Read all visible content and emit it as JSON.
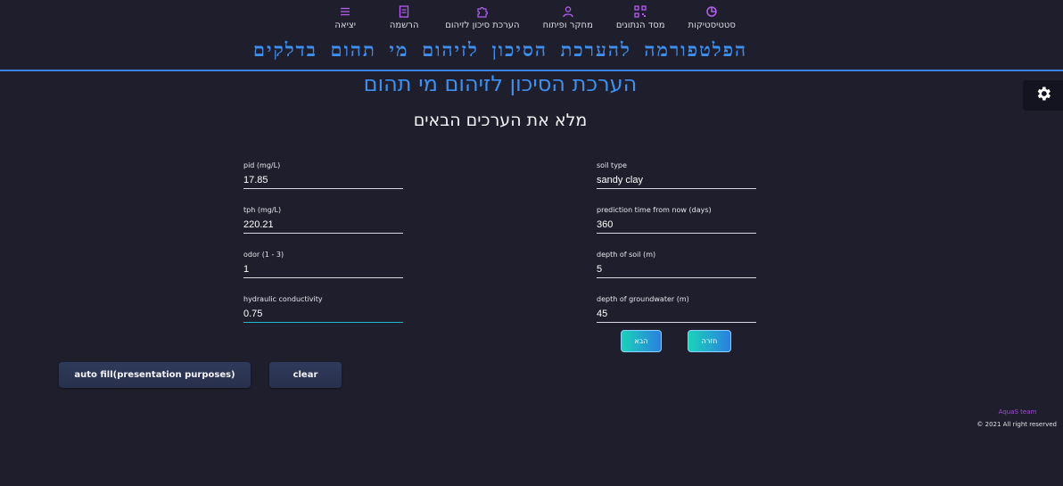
{
  "nav": {
    "items": [
      {
        "label": "סטטיסטיקות",
        "icon": "pie-chart-icon"
      },
      {
        "label": "מסד הנתונים",
        "icon": "qr-code-icon"
      },
      {
        "label": "מחקר ופיתוח",
        "icon": "user-icon"
      },
      {
        "label": "הערכת סיכון לזיהום",
        "icon": "puzzle-icon"
      },
      {
        "label": "הרשמה",
        "icon": "document-icon"
      },
      {
        "label": "יציאה",
        "icon": "menu-lines-icon"
      }
    ],
    "icon_color": "#b45ef0"
  },
  "site_title": "הפלטפורמה להערכת הסיכון לזיהום מי תהום בדלקים",
  "page_title": "הערכת הסיכון לזיהום מי תהום",
  "page_subtitle": "מלא את הערכים הבאים",
  "settings_icon": "gear-icon",
  "form": {
    "left": [
      {
        "label": "pid (mg/L)",
        "value": "17.85"
      },
      {
        "label": "tph (mg/L)",
        "value": "220.21"
      },
      {
        "label": "odor (1 - 3)",
        "value": "1"
      },
      {
        "label": "hydraulic conductivity",
        "value": "0.75"
      }
    ],
    "right": [
      {
        "label": "soil type",
        "value": "sandy clay"
      },
      {
        "label": "prediction time from now (days)",
        "value": "360"
      },
      {
        "label": "depth of soil (m)",
        "value": "5"
      },
      {
        "label": "depth of groundwater (m)",
        "value": "45"
      }
    ]
  },
  "buttons": {
    "next": "הבא",
    "back": "חזרה",
    "autofill": "auto fill(presentation purposes)",
    "clear": "clear"
  },
  "footer": {
    "team": "AquaS team",
    "copyright": "© 2021 All right reserved"
  },
  "colors": {
    "background": "#1f1e2c",
    "accent_blue": "#3d8ff0",
    "nav_icon": "#b45ef0",
    "button_gradient_start": "#1ad3b9",
    "button_gradient_end": "#2a7fe0",
    "team_text": "#a24ad8"
  }
}
